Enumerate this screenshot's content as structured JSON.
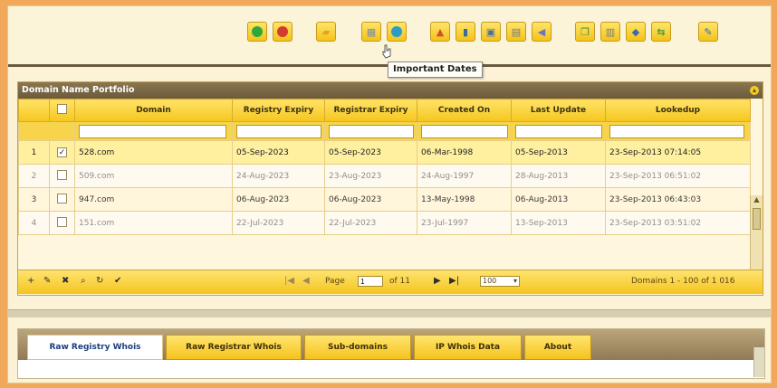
{
  "toolbar": {
    "tooltip": "Important Dates",
    "buttons": [
      {
        "name": "add-icon",
        "glyph": "+",
        "color": "#2ea83a"
      },
      {
        "name": "remove-icon",
        "glyph": "−",
        "color": "#d33b2f"
      },
      {
        "name": "folder-icon",
        "glyph": "▰",
        "color": "#e6a21b"
      },
      {
        "name": "calendar-icon",
        "glyph": "▦",
        "color": "#7b8fa7"
      },
      {
        "name": "globe-icon",
        "glyph": "●",
        "color": "#2b9bc8"
      },
      {
        "name": "user-icon",
        "glyph": "▲",
        "color": "#d05130"
      },
      {
        "name": "books-icon",
        "glyph": "▮",
        "color": "#3b6aa0"
      },
      {
        "name": "monitor-icon",
        "glyph": "▣",
        "color": "#4b6e9d"
      },
      {
        "name": "document-icon",
        "glyph": "▤",
        "color": "#777777"
      },
      {
        "name": "speaker-icon",
        "glyph": "◀",
        "color": "#6a76c3"
      },
      {
        "name": "copy-icon",
        "glyph": "❐",
        "color": "#4c8d35"
      },
      {
        "name": "report-icon",
        "glyph": "▥",
        "color": "#7a7a7a"
      },
      {
        "name": "network-icon",
        "glyph": "◆",
        "color": "#3e6aaa"
      },
      {
        "name": "arrows-icon",
        "glyph": "⇆",
        "color": "#3f9a3f"
      },
      {
        "name": "pen-icon",
        "glyph": "✎",
        "color": "#3b67b5"
      }
    ]
  },
  "grid": {
    "title": "Domain Name Portfolio",
    "columns": [
      "Domain",
      "Registry Expiry",
      "Registrar Expiry",
      "Created On",
      "Last Update",
      "Lookedup"
    ],
    "rows": [
      {
        "num": "1",
        "checked": true,
        "domain": "528.com",
        "registry": "05-Sep-2023",
        "registrar": "05-Sep-2023",
        "created": "06-Mar-1998",
        "updated": "05-Sep-2013",
        "lookedup": "23-Sep-2013 07:14:05"
      },
      {
        "num": "2",
        "checked": false,
        "domain": "509.com",
        "registry": "24-Aug-2023",
        "registrar": "23-Aug-2023",
        "created": "24-Aug-1997",
        "updated": "28-Aug-2013",
        "lookedup": "23-Sep-2013 06:51:02"
      },
      {
        "num": "3",
        "checked": false,
        "domain": "947.com",
        "registry": "06-Aug-2023",
        "registrar": "06-Aug-2023",
        "created": "13-May-1998",
        "updated": "06-Aug-2013",
        "lookedup": "23-Sep-2013 06:43:03"
      },
      {
        "num": "4",
        "checked": false,
        "domain": "151.com",
        "registry": "22-Jul-2023",
        "registrar": "22-Jul-2023",
        "created": "23-Jul-1997",
        "updated": "13-Sep-2013",
        "lookedup": "23-Sep-2013 03:51:02"
      }
    ],
    "pager": {
      "page_label": "Page",
      "page_value": "1",
      "of_label": "of 11",
      "page_size": "100",
      "summary": "Domains 1 - 100 of 1 016"
    }
  },
  "tabs": [
    "Raw Registry Whois",
    "Raw Registrar Whois",
    "Sub-domains",
    "IP Whois Data",
    "About"
  ]
}
